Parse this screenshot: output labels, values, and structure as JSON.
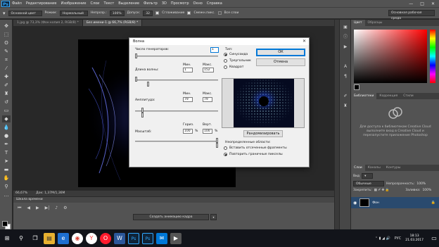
{
  "app": {
    "logo": "Ps"
  },
  "menubar": {
    "items": [
      "Файл",
      "Редактирование",
      "Изображение",
      "Слои",
      "Текст",
      "Выделение",
      "Фильтр",
      "3D",
      "Просмотр",
      "Окно",
      "Справка"
    ],
    "window_controls": [
      "—",
      "□",
      "✕"
    ]
  },
  "options": {
    "preset": "Основной цвет",
    "mode_label": "Режим:",
    "mode_value": "Нормальный",
    "opacity_label": "Непрозр.:",
    "opacity_value": "100%",
    "tolerance_label": "Допуск:",
    "tolerance_value": "32",
    "antialias": "Сглаживание",
    "contiguous": "Смежн.пикс.",
    "all_layers": "Все слои",
    "workspace": "Основная рабочая среда"
  },
  "doc_tabs": [
    {
      "label": "1.jpg @ 73,3% (Фон копия 2, RGB/8) *",
      "active": false
    },
    {
      "label": "Без имени-1 @ 66,7% (RGB/8) *",
      "active": true
    }
  ],
  "status": {
    "zoom": "66,67%",
    "doc_size": "Док: 1,37M/1,36M"
  },
  "timeline": {
    "title": "Шкала времени",
    "create_button": "Создать анимацию кадра"
  },
  "panels": {
    "color_tabs": [
      "Цвет",
      "Образцы"
    ],
    "library_tabs": [
      "Библиотеки",
      "Коррекция",
      "Стили"
    ],
    "library_text": "Для доступа к библиотекам Creative Cloud выполните вход в Creative Cloud и перезапустите приложение Photoshop",
    "layers_tabs": [
      "Слои",
      "Каналы",
      "Контуры"
    ],
    "layers_kind": "Вид",
    "blend_mode": "Обычные",
    "opacity_label": "Непрозрачность:",
    "opacity_value": "100%",
    "lock_label": "Закрепить:",
    "fill_label": "Заливка:",
    "fill_value": "100%",
    "layer_name": "Фон"
  },
  "dialog": {
    "title": "Волна",
    "generators_label": "Число генераторов:",
    "generators_value": "1",
    "wavelength_label": "Длина волны:",
    "min_label": "Мин.",
    "max_label": "Макс.",
    "wavelength_min": "1",
    "wavelength_max": "152",
    "amplitude_label": "Амплитуда:",
    "amplitude_min": "79",
    "amplitude_max": "79",
    "scale_label": "Масштаб:",
    "horiz_label": "Гориз.",
    "vert_label": "Верт.",
    "scale_h": "100",
    "scale_v": "100",
    "pct": "%",
    "type_label": "Тип:",
    "type_options": [
      "Синусоида",
      "Треугольник",
      "Квадрат"
    ],
    "type_selected": 0,
    "ok": "ОК",
    "cancel": "Отмена",
    "randomize": "Рандомизировать",
    "undefined_label": "Неопределенные области:",
    "undefined_options": [
      "Вставить отсеченные фрагменты",
      "Повторить граничные пикселы"
    ],
    "undefined_selected": 1,
    "sliders": {
      "generators": 0.0,
      "wavelength_min": 0.0,
      "wavelength_max": 0.15,
      "amplitude_min": 0.08,
      "amplitude_max": 0.08,
      "scale_h": 1.0,
      "scale_v": 1.0
    }
  },
  "taskbar": {
    "icons": [
      "windows-icon",
      "search-icon",
      "task-view-icon",
      "explorer-icon",
      "edge-icon",
      "chrome-icon",
      "yandex-icon",
      "opera-icon",
      "word-icon",
      "photoshop-icon",
      "photoshop-icon-2",
      "mail-icon",
      "media-icon"
    ],
    "lang": "РУС",
    "time": "18:13",
    "date": "21.03.2017"
  }
}
